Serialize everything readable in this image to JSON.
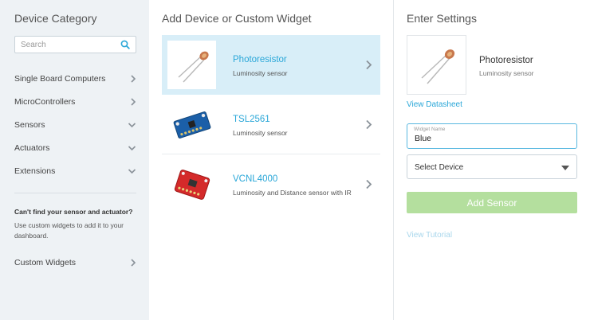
{
  "sidebar": {
    "title": "Device Category",
    "search_placeholder": "Search",
    "categories": [
      {
        "label": "Single Board Computers",
        "chevron": "right"
      },
      {
        "label": "MicroControllers",
        "chevron": "right"
      },
      {
        "label": "Sensors",
        "chevron": "down"
      },
      {
        "label": "Actuators",
        "chevron": "down"
      },
      {
        "label": "Extensions",
        "chevron": "down"
      }
    ],
    "cant_find_title": "Can't find your sensor and actuator?",
    "cant_find_text": "Use custom widgets to add it to your dashboard.",
    "custom_widgets_label": "Custom Widgets"
  },
  "middle": {
    "title": "Add Device or Custom Widget",
    "devices": [
      {
        "name": "Photoresistor",
        "description": "Luminosity sensor",
        "selected": true,
        "icon": "photoresistor-image"
      },
      {
        "name": "TSL2561",
        "description": "Luminosity sensor",
        "selected": false,
        "icon": "tsl2561-board-image"
      },
      {
        "name": "VCNL4000",
        "description": "Luminosity and Distance sensor with IR",
        "selected": false,
        "icon": "vcnl4000-board-image"
      }
    ]
  },
  "settings": {
    "title": "Enter Settings",
    "selected_name": "Photoresistor",
    "selected_description": "Luminosity sensor",
    "datasheet_link": "View Datasheet",
    "widget_name_label": "Widget Name",
    "widget_name_value": "Blue",
    "select_device_label": "Select Device",
    "add_button_label": "Add Sensor",
    "tutorial_link": "View Tutorial"
  },
  "colors": {
    "accent_blue": "#2aa7d8",
    "selected_row_bg": "#d8eef8",
    "add_button_bg": "#b4df9e",
    "sidebar_bg": "#eef2f5"
  }
}
